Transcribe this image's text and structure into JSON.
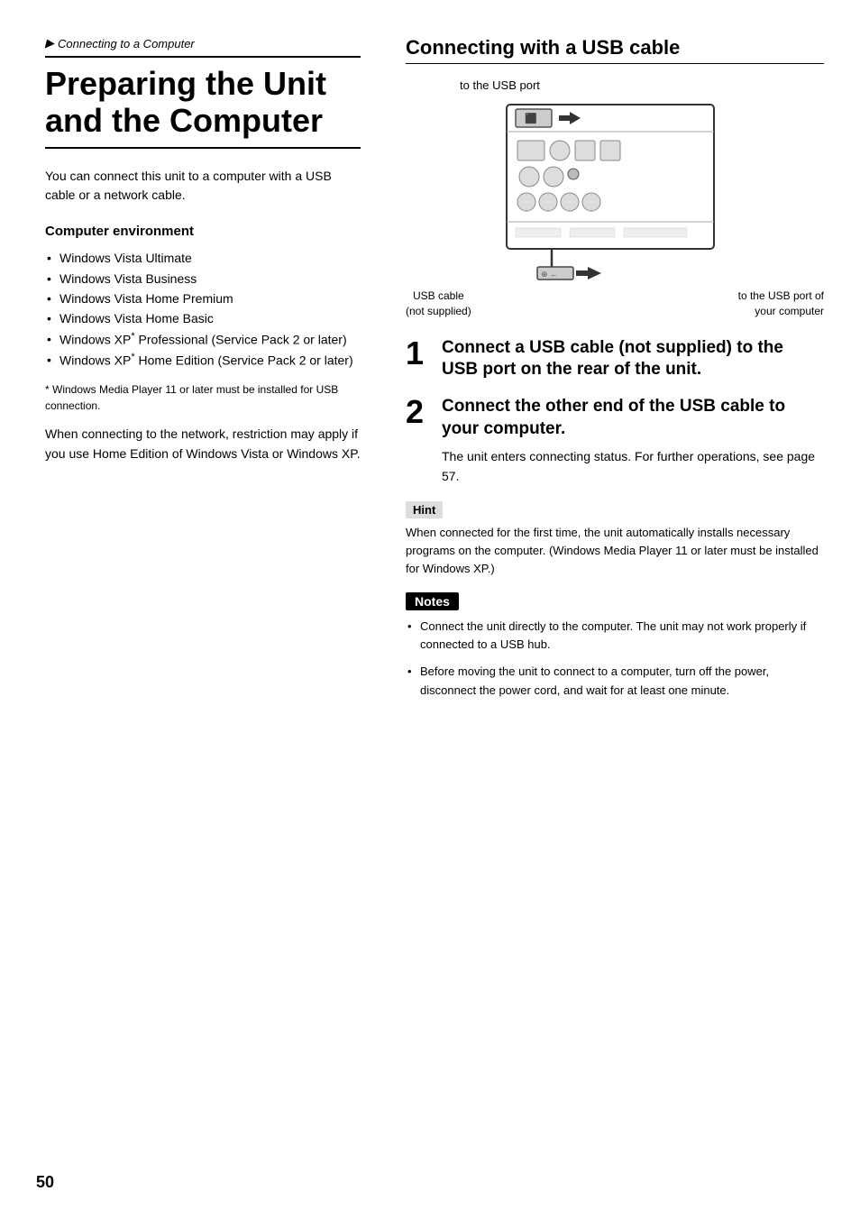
{
  "breadcrumb": {
    "arrow": "▶",
    "text": "Connecting to a Computer"
  },
  "page_title": "Preparing the Unit and the Computer",
  "intro": "You can connect this unit to a computer with a USB cable or a network cable.",
  "computer_environment": {
    "heading": "Computer environment",
    "items": [
      "Windows Vista Ultimate",
      "Windows Vista Business",
      "Windows Vista Home Premium",
      "Windows Vista Home Basic",
      "Windows XP* Professional (Service Pack 2 or later)",
      "Windows XP* Home Edition (Service Pack 2 or later)"
    ],
    "footnote": "* Windows Media Player 11 or later must be installed for USB connection.",
    "network_note": "When connecting to the network, restriction may apply if you use Home Edition of Windows Vista or Windows XP."
  },
  "right_section": {
    "title": "Connecting with a USB cable",
    "diagram": {
      "label_top": "to the USB port",
      "cable_label_left": "USB cable\n(not supplied)",
      "cable_label_right": "to the USB port of\nyour computer"
    },
    "steps": [
      {
        "number": "1",
        "text": "Connect a USB cable (not supplied) to the USB port on the rear of the unit."
      },
      {
        "number": "2",
        "text": "Connect the other end of the USB cable to your computer.",
        "subtext": "The unit enters connecting status. For further operations, see page 57."
      }
    ],
    "hint": {
      "label": "Hint",
      "text": "When connected for the first time, the unit automatically installs necessary programs on the computer. (Windows Media Player 11 or later must be installed for Windows XP.)"
    },
    "notes": {
      "label": "Notes",
      "items": [
        "Connect the unit directly to the computer. The unit may not work properly if connected to a USB hub.",
        "Before moving the unit to connect to a computer, turn off the power, disconnect the power cord, and wait for at least one minute."
      ]
    }
  },
  "page_number": "50"
}
